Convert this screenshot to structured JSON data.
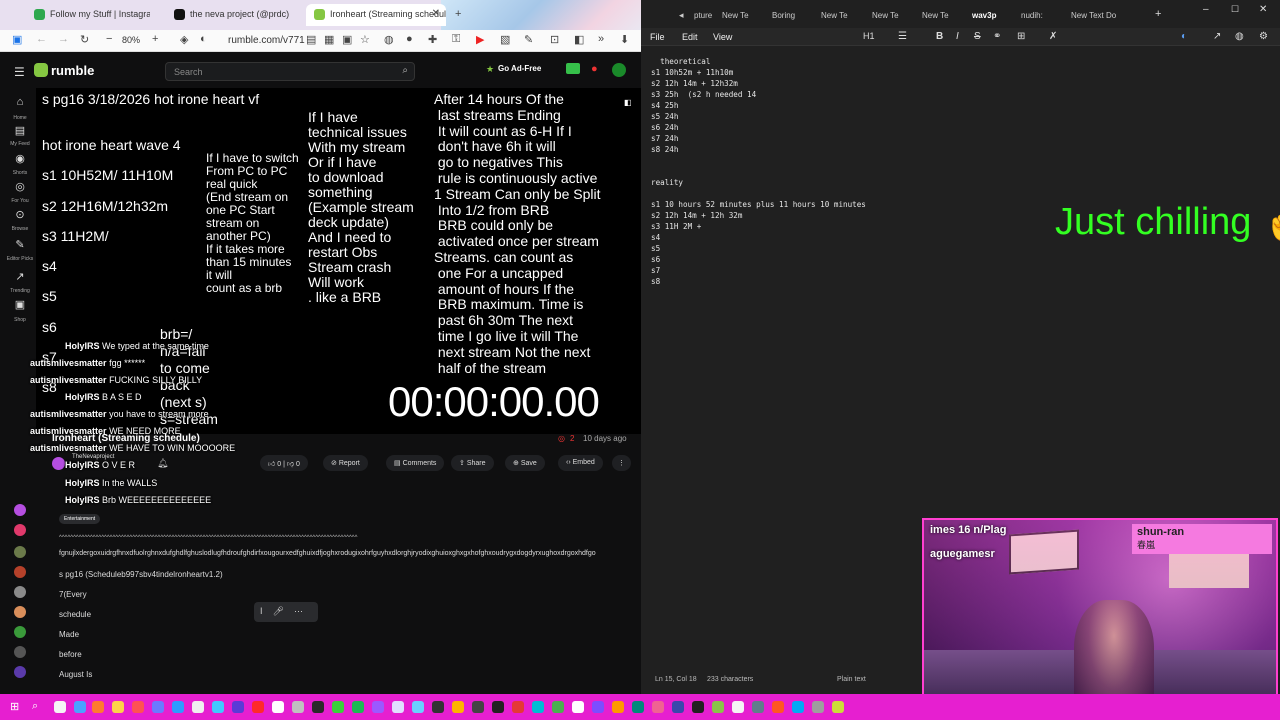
{
  "browser": {
    "tabs": [
      {
        "label": "Follow my Stuff | Instagram, Tik",
        "color": "#2fa84f"
      },
      {
        "label": "the neva project (@prdc)",
        "color": "#111111"
      },
      {
        "label": "Ironheart (Streaming schedule)",
        "color": "#85c742"
      }
    ],
    "zoom": "80%",
    "url": "rumble.com/v771",
    "rumble": {
      "logo": "rumble",
      "search_placeholder": "Search",
      "ad_free": "Go Ad-Free"
    },
    "nav": [
      {
        "icon": "home-icon",
        "glyph": "⌂",
        "label": "Home"
      },
      {
        "icon": "feed-icon",
        "glyph": "▤",
        "label": "My Feed"
      },
      {
        "icon": "shorts-icon",
        "glyph": "◉",
        "label": "Shorts"
      },
      {
        "icon": "for-you-icon",
        "glyph": "◎",
        "label": "For You"
      },
      {
        "icon": "browse-icon",
        "glyph": "⊙",
        "label": "Browse"
      },
      {
        "icon": "editor-picks-icon",
        "glyph": "✎",
        "label": "Editor Picks"
      },
      {
        "icon": "trending-icon",
        "glyph": "↗",
        "label": "Trending"
      },
      {
        "icon": "shop-icon",
        "glyph": "▣",
        "label": "Shop"
      }
    ],
    "stream": {
      "header": "s pg16 3/18/2026 hot irone heart vf",
      "wave": "hot irone heart wave 4",
      "sessions": [
        "s1 10H52M/ 11H10M",
        "s2 12H16M/12h32m",
        "s3 11H2M/",
        "s4",
        "s5",
        "s6",
        "s7",
        "s8"
      ],
      "switch_note": "If I have to switch\nFrom PC to PC\nreal quick\n(End stream on\none PC Start\nstream on\nanother PC)\nIf it takes more\nthan 15 minutes\nit will\ncount as a brb",
      "tech_note": "If I have\ntechnical issues\nWith my stream\nOr if I have\nto download\nsomething\n(Example stream\ndeck update)\nAnd I need to\nrestart Obs\nStream crash\nWill work\n. like a BRB",
      "rules_note": "After 14 hours Of the\n last streams Ending\n It will count as 6-H If I\n don't have 6h it will\n go to negatives This\n rule is continuously active\n1 Stream Can only be Split\n Into 1/2 from BRB\n BRB could only be\n activated once per stream\nStreams. can count as\n one For a uncapped\n amount of hours If the\n BRB maximum. Time is\n past 6h 30m The next\n time I go live it will The\n next stream Not the next\n half of the stream",
      "brb_note": "brb=/\nn/a=fail\nto come\nback\n(next s)\ns=stream",
      "timer": "00:00:00.00"
    },
    "chat": [
      {
        "user": "HolyIRS",
        "msg": "We typed at the same time"
      },
      {
        "user": "autismlivesmatter",
        "msg": "fgg ******"
      },
      {
        "user": "autismlivesmatter",
        "msg": "FUCKING SILLY BILLY"
      },
      {
        "user": "HolyIRS",
        "msg": "B A S E D"
      },
      {
        "user": "autismlivesmatter",
        "msg": "you have to stream more"
      },
      {
        "user": "autismlivesmatter",
        "msg": "WE NEED MORE"
      },
      {
        "user": "autismlivesmatter",
        "msg": "WE HAVE TO WIN MOOOORE"
      },
      {
        "user": "HolyIRS",
        "msg": "O V E R"
      },
      {
        "user": "HolyIRS",
        "msg": "In the WALLS"
      },
      {
        "user": "HolyIRS",
        "msg": "Brb WEEEEEEEEEEEEEE"
      }
    ],
    "video": {
      "title": "Ironheart (Streaming schedule)",
      "channel": "TheNevaproject",
      "comment_count": "2",
      "age": "10 days ago",
      "likes": "0",
      "dislikes": "0",
      "actions": {
        "report": "Report",
        "comments": "Comments",
        "share": "Share",
        "save": "Save",
        "embed": "Embed"
      }
    },
    "description": {
      "tag": "Entertainment",
      "carets": "^^^^^^^^^^^^^^^^^^^^^^^^^^^^^^^^^^^^^^^^^^^^^^^^^^^^^^^^^^^^^^^^^^^^^^^^^^^^^^^^^^^^^^^^^^^^^^^^^^^^^^^^^^",
      "gibberish": "fgnujlxdergoxuidrgfhnxdfuolrghnxdufghdlfghuslodlugfhdroufghdirfxougourxedfghuixdfjoghxrodugixohrfguyhxdlorghjryodixghuioxghxgxhofghxoudrygxdogdyrxughoxdrgoxhdfgo",
      "lines": [
        "s pg16 (Scheduleb997sbv4tindelronheartv1.2)",
        "7(Every",
        "schedule",
        "Made",
        "before",
        "August Is"
      ]
    }
  },
  "notepad": {
    "tabs": [
      "pture",
      "New Te",
      "Boring",
      "New Te",
      "New Te",
      "New Te",
      "wav3p",
      "nudih:",
      "New Text Do"
    ],
    "active_tab": "wav3p",
    "menu": [
      "File",
      "Edit",
      "View"
    ],
    "heading_level": "H1",
    "text": "  theoretical\ns1 10h52m + 11h10m\ns2 12h 14m + 12h32m\ns3 25h  (s2 h needed 14\ns4 25h\ns5 24h\ns6 24h\ns7 24h\ns8 24h\n\n\nreality\n\ns1 10 hours 52 minutes plus 11 hours 10 minutes\ns2 12h 14m + 12h 32m\ns3 11H 2M +\ns4\ns5\ns6\ns7\ns8",
    "status": {
      "position": "Ln 15, Col 18",
      "chars": "233 characters",
      "mode": "Plain text"
    }
  },
  "overlay": {
    "chill": "Just chilling",
    "chill_color": "#33ff22"
  },
  "webcam": {
    "line1": "imes 16 n/Plag",
    "line2": "aguegamesr",
    "name": "shun-ran",
    "name_cjk": "春嵐",
    "border_color": "#ff3fd0"
  },
  "taskbar": {
    "color": "#e61fd0"
  }
}
